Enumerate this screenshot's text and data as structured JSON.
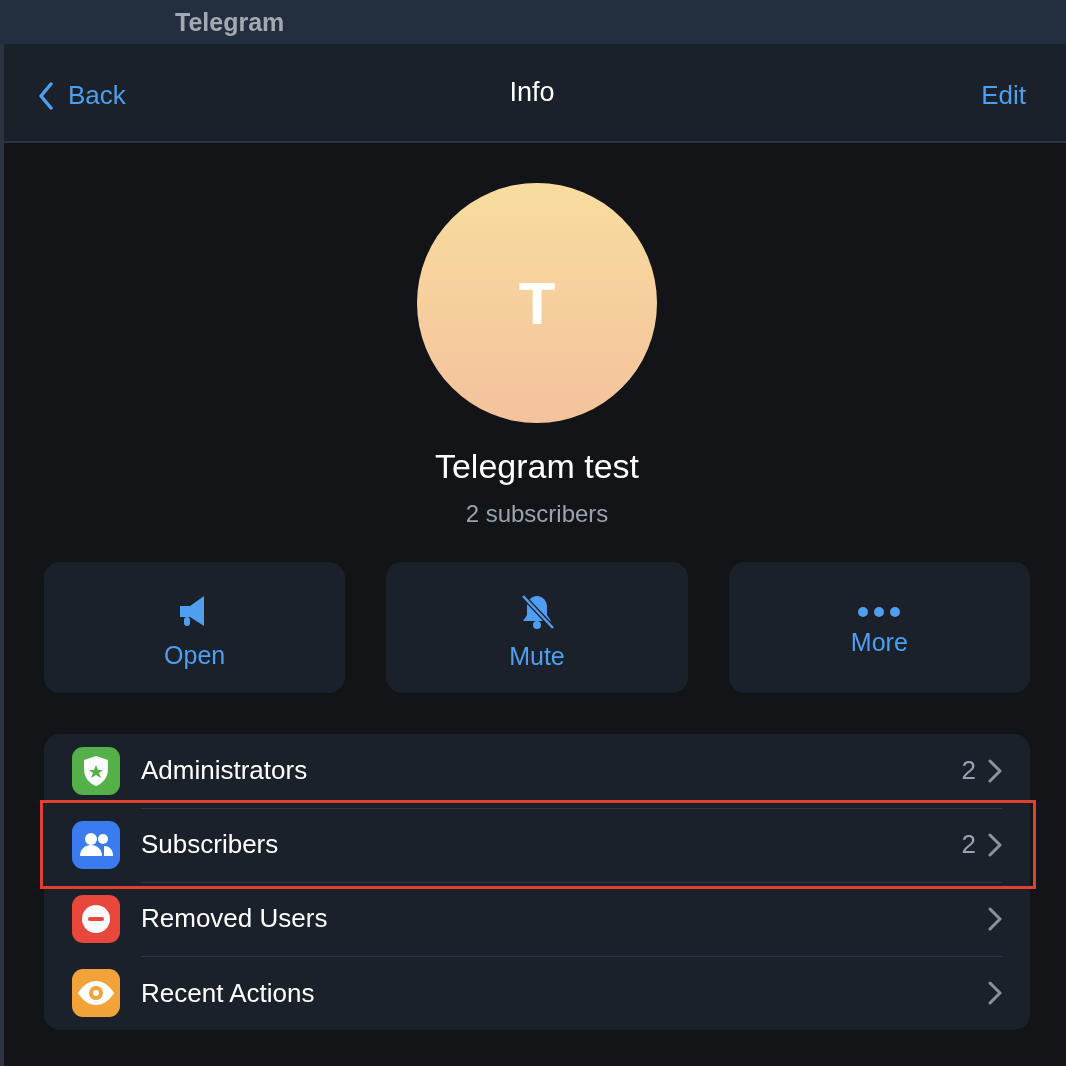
{
  "window": {
    "title": "Telegram"
  },
  "nav": {
    "back": "Back",
    "title": "Info",
    "action": "Edit"
  },
  "profile": {
    "initial": "T",
    "name": "Telegram test",
    "subtitle": "2 subscribers"
  },
  "actions": [
    {
      "kind": "megaphone",
      "label": "Open"
    },
    {
      "kind": "mute",
      "label": "Mute"
    },
    {
      "kind": "more",
      "label": "More"
    }
  ],
  "items": [
    {
      "kind": "shield",
      "label": "Administrators",
      "count": "2",
      "color": "#55b04a",
      "highlighted": false
    },
    {
      "kind": "people",
      "label": "Subscribers",
      "count": "2",
      "color": "#3a7cf0",
      "highlighted": true
    },
    {
      "kind": "removed",
      "label": "Removed Users",
      "color": "#e8483b",
      "highlighted": false
    },
    {
      "kind": "eye",
      "label": "Recent Actions",
      "color": "#f2a23a",
      "highlighted": false
    }
  ]
}
